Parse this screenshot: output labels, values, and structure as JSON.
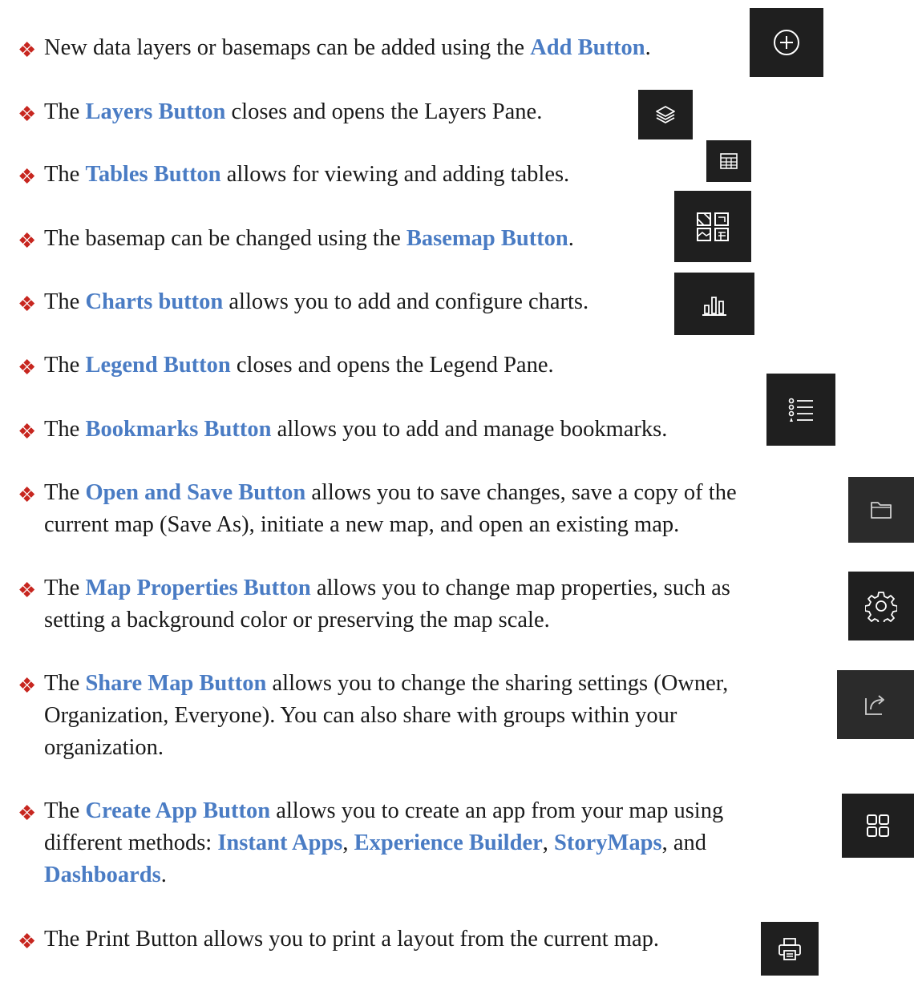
{
  "items": [
    {
      "pre": "New data layers or basemaps can be added using the ",
      "hl": "Add Button",
      "post": ".",
      "icon": "add-icon"
    },
    {
      "pre": "The ",
      "hl": "Layers Button",
      "post": " closes and opens the Layers Pane.",
      "icon": "layers-icon"
    },
    {
      "pre": "The ",
      "hl": "Tables Button",
      "post": " allows for viewing and adding tables.",
      "icon": "table-icon"
    },
    {
      "pre": "The basemap can be changed using the ",
      "hl": "Basemap Button",
      "post": ".",
      "icon": "basemap-gallery-icon"
    },
    {
      "pre": "The ",
      "hl": "Charts button",
      "post": " allows you to add and configure charts.",
      "icon": "bar-chart-icon"
    },
    {
      "pre": "The ",
      "hl": "Legend Button",
      "post": " closes and opens the Legend Pane.",
      "icon": "legend-icon"
    },
    {
      "pre": "The ",
      "hl": "Bookmarks Button",
      "post": " allows you to add and manage bookmarks.",
      "icon": "bookmarks-list-icon"
    },
    {
      "pre": "The ",
      "hl": "Open and Save Button",
      "post1": " allows you to save changes, save a copy of the",
      "line2": "current map (Save As), initiate a new map, and open an existing map.",
      "icon": "folder-icon"
    },
    {
      "pre": "The ",
      "hl": "Map Properties Button",
      "post1": " allows you to change map properties, such as",
      "line2": "setting a background color or preserving the map scale.",
      "icon": "gear-icon"
    },
    {
      "pre": "The ",
      "hl": "Share Map Button",
      "post1": " allows you to change the sharing settings (Owner,",
      "line2": "Organization, Everyone). You can also share with groups within your",
      "line3": "organization.",
      "icon": "share-icon"
    },
    {
      "pre": "The ",
      "hl": "Create App Button",
      "post1": " allows you to create an app from your map using",
      "line2_pre": "different methods: ",
      "app1": "Instant Apps",
      "sep1": ", ",
      "app2": "Experience Builder",
      "sep2": ", ",
      "app3": "StoryMaps",
      "sep3": ", and",
      "app4": "Dashboards",
      "end": ".",
      "icon": "apps-grid-icon"
    },
    {
      "text": "The Print Button allows you to print a layout from the current map.",
      "icon": "printer-icon"
    }
  ],
  "bullet_glyph": "❖",
  "colors": {
    "accent": "#4a7cc4",
    "bullet": "#c7261f",
    "icon_bg_dark": "#1f1f1f",
    "icon_bg_mid": "#2b2b2b"
  }
}
